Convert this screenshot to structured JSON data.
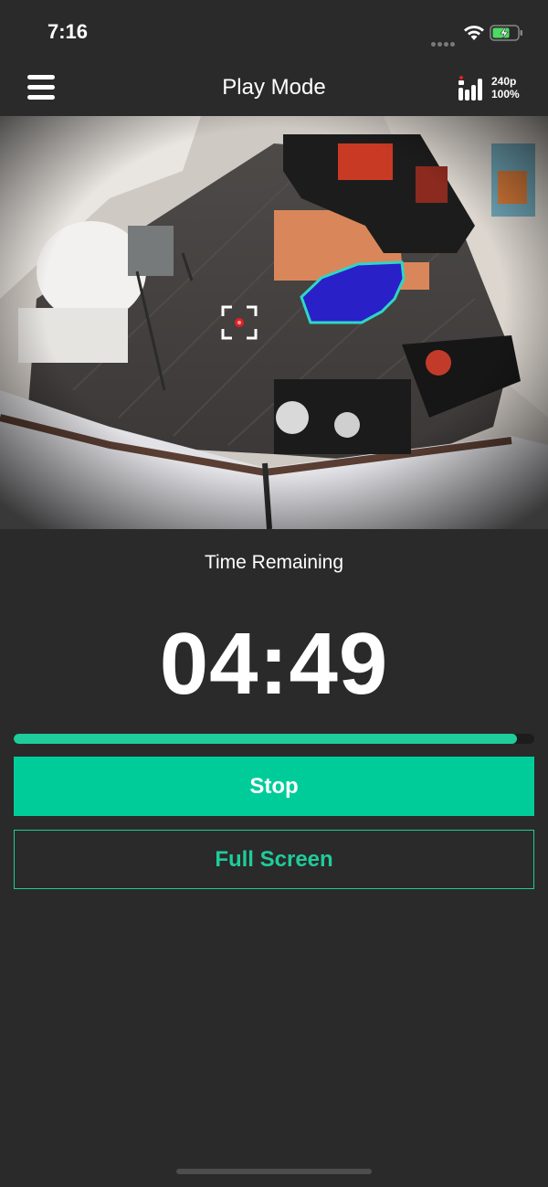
{
  "status_bar": {
    "time": "7:16",
    "icons": [
      "signal-dots-icon",
      "wifi-icon",
      "battery-charging-icon"
    ]
  },
  "header": {
    "title": "Play Mode",
    "menu_icon": "hamburger-menu-icon",
    "quality_icon": "connection-quality-icon",
    "resolution": "240p",
    "quality_percent": "100%"
  },
  "camera": {
    "reticle_icon": "focus-reticle-icon"
  },
  "timer": {
    "label": "Time Remaining",
    "value": "04:49",
    "progress": 0.966
  },
  "buttons": {
    "stop": "Stop",
    "full_screen": "Full Screen"
  },
  "colors": {
    "background": "#2a2a2a",
    "accent": "#00cc9a",
    "zone_outline": "#2ed6c4",
    "laser_zone": "#2a20c8",
    "focus_dot": "#e0202a"
  }
}
